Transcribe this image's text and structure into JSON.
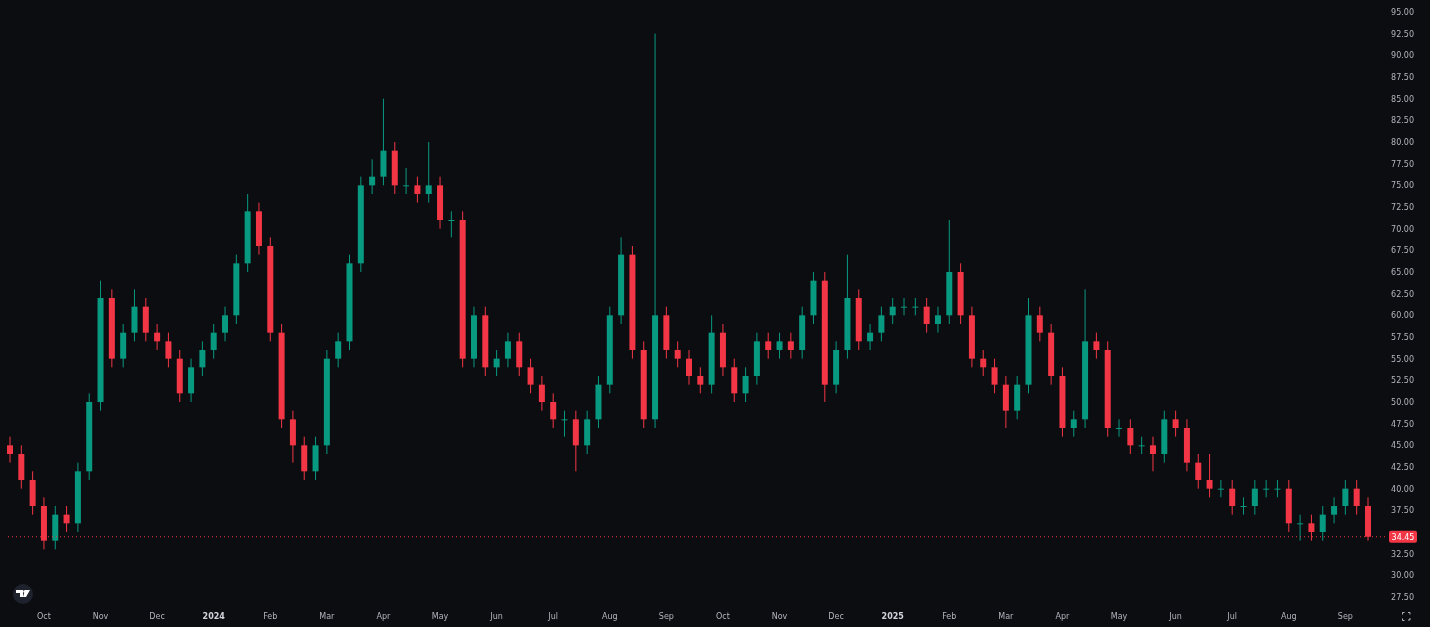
{
  "chart": {
    "chart_data": {
      "type": "candlestick",
      "categories": [
        null,
        null,
        null,
        "Oct",
        null,
        null,
        null,
        null,
        "Nov",
        null,
        null,
        null,
        null,
        "Dec",
        null,
        null,
        null,
        null,
        "2024",
        null,
        null,
        null,
        null,
        "Feb",
        null,
        null,
        null,
        null,
        "Mar",
        null,
        null,
        null,
        null,
        "Apr",
        null,
        null,
        null,
        null,
        "May",
        null,
        null,
        null,
        null,
        "Jun",
        null,
        null,
        null,
        null,
        "Jul",
        null,
        null,
        null,
        null,
        "Aug",
        null,
        null,
        null,
        null,
        "Sep",
        null,
        null,
        null,
        null,
        "Oct",
        null,
        null,
        null,
        null,
        "Nov",
        null,
        null,
        null,
        null,
        "Dec",
        null,
        null,
        null,
        null,
        "2025",
        null,
        null,
        null,
        null,
        "Feb",
        null,
        null,
        null,
        null,
        "Mar",
        null,
        null,
        null,
        null,
        "Apr",
        null,
        null,
        null,
        null,
        "May",
        null,
        null,
        null,
        null,
        "Jun",
        null,
        null,
        null,
        null,
        "Jul",
        null,
        null,
        null,
        null,
        "Aug",
        null,
        null,
        null,
        null,
        "Sep",
        null,
        null
      ],
      "ohlc": [
        [
          45,
          46,
          43,
          44
        ],
        [
          44,
          45,
          40,
          41
        ],
        [
          41,
          42,
          37,
          38
        ],
        [
          38,
          39,
          33,
          34
        ],
        [
          34,
          38,
          33,
          37
        ],
        [
          37,
          38,
          35,
          36
        ],
        [
          36,
          43,
          35,
          42
        ],
        [
          42,
          51,
          41,
          50
        ],
        [
          50,
          64,
          49,
          62
        ],
        [
          62,
          63,
          54,
          55
        ],
        [
          55,
          59,
          54,
          58
        ],
        [
          58,
          63,
          57,
          61
        ],
        [
          61,
          62,
          57,
          58
        ],
        [
          58,
          59,
          56,
          57
        ],
        [
          57,
          58,
          54,
          55
        ],
        [
          55,
          56,
          50,
          51
        ],
        [
          51,
          55,
          50,
          54
        ],
        [
          54,
          57,
          53,
          56
        ],
        [
          56,
          59,
          55,
          58
        ],
        [
          58,
          61,
          57,
          60
        ],
        [
          60,
          67,
          59,
          66
        ],
        [
          66,
          74,
          65,
          72
        ],
        [
          72,
          73,
          67,
          68
        ],
        [
          68,
          69,
          57,
          58
        ],
        [
          58,
          59,
          47,
          48
        ],
        [
          48,
          49,
          43,
          45
        ],
        [
          45,
          46,
          41,
          42
        ],
        [
          42,
          46,
          41,
          45
        ],
        [
          45,
          56,
          44,
          55
        ],
        [
          55,
          58,
          54,
          57
        ],
        [
          57,
          67,
          56,
          66
        ],
        [
          66,
          76,
          65,
          75
        ],
        [
          75,
          78,
          74,
          76
        ],
        [
          76,
          85,
          75,
          79
        ],
        [
          79,
          80,
          74,
          75
        ],
        [
          75,
          77,
          74,
          75
        ],
        [
          75,
          76,
          73,
          74
        ],
        [
          74,
          80,
          73,
          75
        ],
        [
          75,
          76,
          70,
          71
        ],
        [
          71,
          72,
          69,
          71
        ],
        [
          71,
          72,
          54,
          55
        ],
        [
          55,
          61,
          54,
          60
        ],
        [
          60,
          61,
          53,
          54
        ],
        [
          54,
          56,
          53,
          55
        ],
        [
          55,
          58,
          54,
          57
        ],
        [
          57,
          58,
          53,
          54
        ],
        [
          54,
          55,
          51,
          52
        ],
        [
          52,
          53,
          49,
          50
        ],
        [
          50,
          51,
          47,
          48
        ],
        [
          48,
          49,
          46,
          48
        ],
        [
          48,
          49,
          42,
          45
        ],
        [
          45,
          49,
          44,
          48
        ],
        [
          48,
          53,
          47,
          52
        ],
        [
          52,
          61,
          51,
          60
        ],
        [
          60,
          69,
          59,
          67
        ],
        [
          67,
          68,
          55,
          56
        ],
        [
          56,
          57,
          47,
          48
        ],
        [
          48,
          92.5,
          47,
          60
        ],
        [
          60,
          61,
          55,
          56
        ],
        [
          56,
          57,
          54,
          55
        ],
        [
          55,
          56,
          52,
          53
        ],
        [
          53,
          54,
          51,
          52
        ],
        [
          52,
          60,
          51,
          58
        ],
        [
          58,
          59,
          53,
          54
        ],
        [
          54,
          55,
          50,
          51
        ],
        [
          51,
          54,
          50,
          53
        ],
        [
          53,
          58,
          52,
          57
        ],
        [
          57,
          58,
          55,
          56
        ],
        [
          56,
          58,
          55,
          57
        ],
        [
          57,
          58,
          55,
          56
        ],
        [
          56,
          61,
          55,
          60
        ],
        [
          60,
          65,
          59,
          64
        ],
        [
          64,
          65,
          50,
          52
        ],
        [
          52,
          57,
          51,
          56
        ],
        [
          56,
          67,
          55,
          62
        ],
        [
          62,
          63,
          56,
          57
        ],
        [
          57,
          59,
          56,
          58
        ],
        [
          58,
          61,
          57,
          60
        ],
        [
          60,
          62,
          59,
          61
        ],
        [
          61,
          62,
          60,
          61
        ],
        [
          61,
          62,
          60,
          61
        ],
        [
          61,
          62,
          58,
          59
        ],
        [
          59,
          61,
          58,
          60
        ],
        [
          60,
          71,
          59,
          65
        ],
        [
          65,
          66,
          59,
          60
        ],
        [
          60,
          61,
          54,
          55
        ],
        [
          55,
          56,
          53,
          54
        ],
        [
          54,
          55,
          51,
          52
        ],
        [
          52,
          53,
          47,
          49
        ],
        [
          49,
          53,
          48,
          52
        ],
        [
          52,
          62,
          51,
          60
        ],
        [
          60,
          61,
          57,
          58
        ],
        [
          58,
          59,
          52,
          53
        ],
        [
          53,
          54,
          46,
          47
        ],
        [
          47,
          49,
          46,
          48
        ],
        [
          48,
          63,
          47,
          57
        ],
        [
          57,
          58,
          55,
          56
        ],
        [
          56,
          57,
          46,
          47
        ],
        [
          47,
          48,
          46,
          47
        ],
        [
          47,
          48,
          44,
          45
        ],
        [
          45,
          46,
          44,
          45
        ],
        [
          45,
          46,
          42,
          44
        ],
        [
          44,
          49,
          43,
          48
        ],
        [
          48,
          49,
          46,
          47
        ],
        [
          47,
          48,
          42,
          43
        ],
        [
          43,
          44,
          40,
          41
        ],
        [
          41,
          44,
          39,
          40
        ],
        [
          40,
          41,
          39,
          40
        ],
        [
          40,
          41,
          37,
          38
        ],
        [
          38,
          39,
          37,
          38
        ],
        [
          38,
          41,
          37,
          40
        ],
        [
          40,
          41,
          39,
          40
        ],
        [
          40,
          41,
          39,
          40
        ],
        [
          40,
          41,
          35,
          36
        ],
        [
          36,
          37,
          34,
          36
        ],
        [
          36,
          37,
          34,
          35
        ],
        [
          35,
          38,
          34,
          37
        ],
        [
          37,
          39,
          36,
          38
        ],
        [
          38,
          41,
          37,
          40
        ],
        [
          40,
          41,
          37,
          38
        ],
        [
          38,
          39,
          34,
          34.45
        ]
      ],
      "ylim": [
        27.5,
        95
      ],
      "yticks": [
        {
          "value": 95,
          "label": "95.00"
        },
        {
          "value": 92.5,
          "label": "92.50"
        },
        {
          "value": 90,
          "label": "90.00"
        },
        {
          "value": 87.5,
          "label": "87.50"
        },
        {
          "value": 85,
          "label": "85.00"
        },
        {
          "value": 82.5,
          "label": "82.50"
        },
        {
          "value": 80,
          "label": "80.00"
        },
        {
          "value": 77.5,
          "label": "77.50"
        },
        {
          "value": 75,
          "label": "75.00"
        },
        {
          "value": 72.5,
          "label": "72.50"
        },
        {
          "value": 70,
          "label": "70.00"
        },
        {
          "value": 67.5,
          "label": "67.50"
        },
        {
          "value": 65,
          "label": "65.00"
        },
        {
          "value": 62.5,
          "label": "62.50"
        },
        {
          "value": 60,
          "label": "60.00"
        },
        {
          "value": 57.5,
          "label": "57.50"
        },
        {
          "value": 55,
          "label": "55.00"
        },
        {
          "value": 52.5,
          "label": "52.50"
        },
        {
          "value": 50,
          "label": "50.00"
        },
        {
          "value": 47.5,
          "label": "47.50"
        },
        {
          "value": 45,
          "label": "45.00"
        },
        {
          "value": 42.5,
          "label": "42.50"
        },
        {
          "value": 40,
          "label": "40.00"
        },
        {
          "value": 37.5,
          "label": "37.50"
        },
        {
          "value": 32.5,
          "label": "32.50"
        },
        {
          "value": 30,
          "label": "30.00"
        },
        {
          "value": 27.5,
          "label": "27.50"
        }
      ],
      "ref_lines": [
        {
          "axis": "y",
          "value": 34.45,
          "label": "34.45",
          "color": "#f23645"
        }
      ]
    }
  }
}
